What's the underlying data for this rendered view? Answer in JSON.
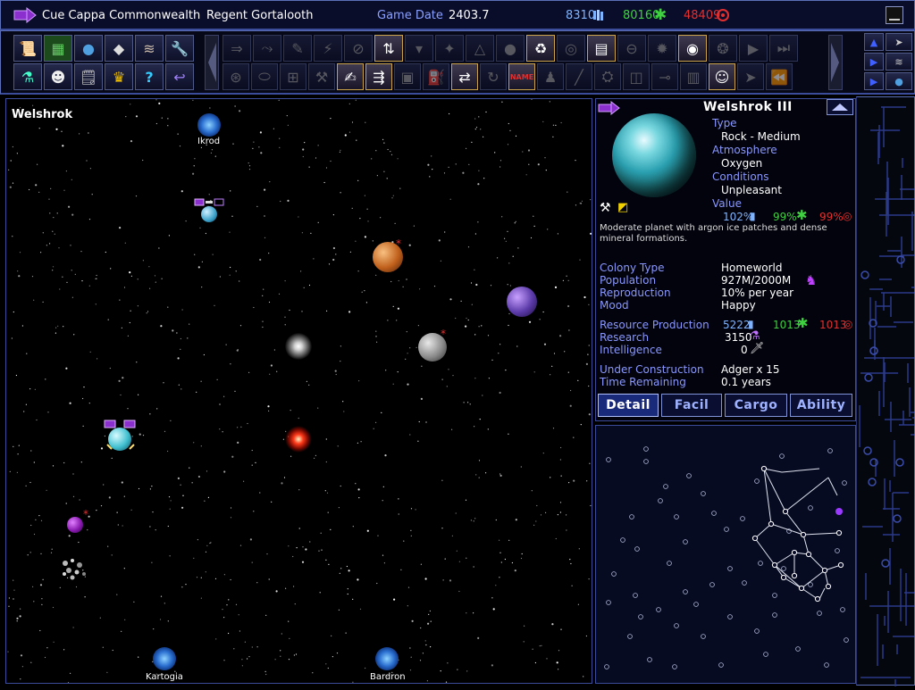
{
  "header": {
    "empire": "Cue Cappa Commonwealth",
    "ruler": "Regent Gortalooth",
    "date_label": "Game Date",
    "date_value": "2403.7",
    "resources": {
      "organics": "8310",
      "minerals": "80160",
      "radioactives": "48409"
    }
  },
  "map": {
    "system_name": "Welshrok",
    "warp_points": [
      "Ikrod",
      "Kartogia",
      "Bardron"
    ]
  },
  "planet": {
    "name": "Welshrok III",
    "type_label": "Type",
    "type_value": "Rock - Medium",
    "atmos_label": "Atmosphere",
    "atmos_value": "Oxygen",
    "cond_label": "Conditions",
    "cond_value": "Unpleasant",
    "value_label": "Value",
    "value_org": "102%",
    "value_min": "99%",
    "value_rad": "99%",
    "description": "Moderate planet with argon ice patches and dense mineral formations.",
    "colony_type_label": "Colony Type",
    "colony_type": "Homeworld",
    "population_label": "Population",
    "population": "927M/2000M",
    "reproduction_label": "Reproduction",
    "reproduction": "10% per year",
    "mood_label": "Mood",
    "mood": "Happy",
    "resprod_label": "Resource Production",
    "resprod_org": "5222",
    "resprod_min": "1013",
    "resprod_rad": "1013",
    "research_label": "Research",
    "research": "3150",
    "intel_label": "Intelligence",
    "intel": "0",
    "construction_label": "Under Construction",
    "construction": "Adger x 15",
    "time_label": "Time Remaining",
    "time": "0.1 years",
    "tabs": [
      "Detail",
      "Facil",
      "Cargo",
      "Ability"
    ],
    "active_tab": "Detail"
  },
  "toolbar": {
    "left_icons": [
      "empire-status-icon",
      "design-icon",
      "planets-icon",
      "ships-icon",
      "fleets-icon",
      "construction-icon",
      "research-icon",
      "aliens-icon",
      "log-icon",
      "empire-crown-icon",
      "help-icon",
      "transfer-icon"
    ],
    "order_icons_row1": [
      "move-icon",
      "path-icon",
      "warp-icon",
      "attack-icon",
      "cancel-icon",
      "cargo-icon",
      "drop-icon",
      "lay-mines-icon",
      "formation-icon",
      "sphere-icon",
      "recycle-icon",
      "ring-icon",
      "scrap-icon",
      "repair-icon",
      "colonize-icon",
      "planet-alien-icon",
      "vortex-icon",
      "play-icon",
      "skip-end-icon"
    ],
    "order_icons_row2": [
      "sentry-icon",
      "saucer-icon",
      "construct-icon",
      "tools-icon",
      "analyze-icon",
      "fleet-icon",
      "mine-icon",
      "refuel-icon",
      "convert-icon",
      "cycle-icon",
      "rename-icon",
      "chess-icon",
      "sweep-icon",
      "salvage-icon",
      "wreck-icon",
      "cannon-icon",
      "tank-icon",
      "head-icon",
      "ship-icon",
      "rewind-icon"
    ],
    "rename_label": "NAME"
  },
  "colors": {
    "organics": "#7eb4ff",
    "minerals": "#3fd140",
    "radioactives": "#e23030",
    "accent": "#8a98ff",
    "frame": "#3a4c9a"
  }
}
